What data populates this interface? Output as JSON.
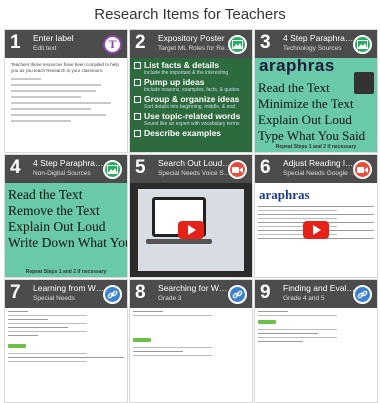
{
  "page": {
    "title": "Research Items for Teachers"
  },
  "colors": {
    "header_overlay": "#2d2d2d",
    "text_badge": "#8e44ad",
    "image_badge": "#27ae60",
    "video_badge": "#e74c3c",
    "link_badge": "#3b82d4",
    "poster_green": "#2d6a3e",
    "sticky_teal": "#69c9a9"
  },
  "tiles": [
    {
      "number": "1",
      "title": "Enter label",
      "subtitle": "Edit text",
      "badge": "text-icon",
      "content": {
        "heading": "Teachers these resources have been compiled to help you as you teach Research in your classroom."
      }
    },
    {
      "number": "2",
      "title": "Expository Poster",
      "subtitle": "Target ML Roles for Res...",
      "badge": "image-icon",
      "content": {
        "items": [
          {
            "label": "List facts & details",
            "sub": "Include the important & the interesting"
          },
          {
            "label": "Pump up ideas",
            "sub": "Include reasons, examples, facts, & quotes"
          },
          {
            "label": "Group & organize ideas",
            "sub": "Sort details into beginning, middle, & end"
          },
          {
            "label": "Use topic-related words",
            "sub": "Sound like an expert with vocabulary terms"
          },
          {
            "label": "Describe examples",
            "sub": ""
          }
        ]
      }
    },
    {
      "number": "3",
      "title": "4 Step Paraphrase Pos...",
      "subtitle": "Technology Sources",
      "badge": "image-icon",
      "content": {
        "banner": "araphras",
        "lines": [
          "Read the Text",
          "Minimize the Text",
          "Explain Out Loud",
          "Type What You Said"
        ],
        "footer": "Repeat Steps 1 and 2 if necessary"
      }
    },
    {
      "number": "4",
      "title": "4 Step Paraphrase Pos...",
      "subtitle": "Non-Digital Sources",
      "badge": "image-icon",
      "content": {
        "lines": [
          "Read the Text",
          "Remove the Text",
          "Explain Out Loud",
          "Write Down What You S"
        ],
        "footer": "Repeat Steps 1 and 2 if necessary"
      }
    },
    {
      "number": "5",
      "title": "Search Out Loud with",
      "subtitle": "Special Needs Voice Se...",
      "badge": "video-icon"
    },
    {
      "number": "6",
      "title": "Adjust Reading level",
      "subtitle": "Special Needs Google S...",
      "badge": "video-icon"
    },
    {
      "number": "7",
      "title": "Learning from Web Sites",
      "subtitle": "Special Needs",
      "badge": "link-icon"
    },
    {
      "number": "8",
      "title": "Searching for Web Sites",
      "subtitle": "Grade 3",
      "badge": "link-icon"
    },
    {
      "number": "9",
      "title": "Finding and Evaluating",
      "subtitle": "Grade 4 and 5",
      "badge": "link-icon"
    }
  ]
}
